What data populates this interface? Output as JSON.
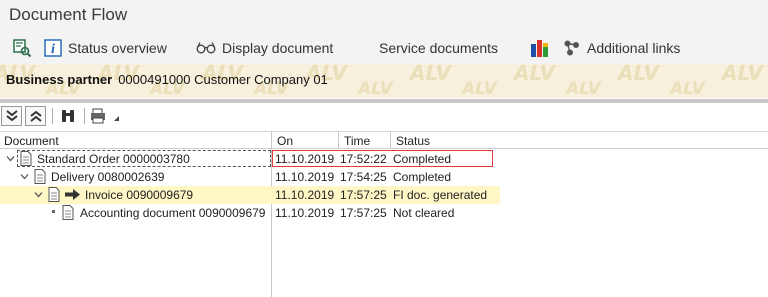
{
  "window": {
    "title": "Document Flow"
  },
  "toolbar": {
    "items": [
      {
        "label": "",
        "icon": "glasses-find-icon"
      },
      {
        "label": "Status overview",
        "icon": "info-icon"
      },
      {
        "label": "Display document",
        "icon": "glasses-icon"
      },
      {
        "label": "Service documents",
        "icon": ""
      },
      {
        "label": "",
        "icon": "bar-chart-icon"
      },
      {
        "label": "Additional links",
        "icon": "links-icon"
      }
    ]
  },
  "partner": {
    "label": "Business partner",
    "value": "0000491000 Customer Company 01",
    "watermark": "ALV"
  },
  "alv_toolbar": {
    "buttons": [
      "expand-all-icon",
      "collapse-all-icon",
      "find-icon",
      "print-icon"
    ]
  },
  "grid": {
    "columns": [
      "Document",
      "On",
      "Time",
      "Status"
    ],
    "rows": [
      {
        "document": "Standard Order 0000003780",
        "on": "11.10.2019",
        "time": "17:52:22",
        "status": "Completed",
        "level": 0,
        "expanded": true,
        "current": false
      },
      {
        "document": "Delivery 0080002639",
        "on": "11.10.2019",
        "time": "17:54:25",
        "status": "Completed",
        "level": 1,
        "expanded": true,
        "current": false
      },
      {
        "document": "Invoice 0090009679",
        "on": "11.10.2019",
        "time": "17:57:25",
        "status": "FI doc. generated",
        "level": 2,
        "expanded": true,
        "current": true
      },
      {
        "document": "Accounting document 0090009679",
        "on": "11.10.2019",
        "time": "17:57:25",
        "status": "Not cleared",
        "level": 3,
        "expanded": false,
        "current": false
      }
    ]
  },
  "colors": {
    "titlebar_bg": "#f3f3f3",
    "partner_bg": "#f6f0dc",
    "highlight_row": "#fff7c6",
    "info_blue": "#1f63b5",
    "selection_red": "#e23a3a"
  }
}
